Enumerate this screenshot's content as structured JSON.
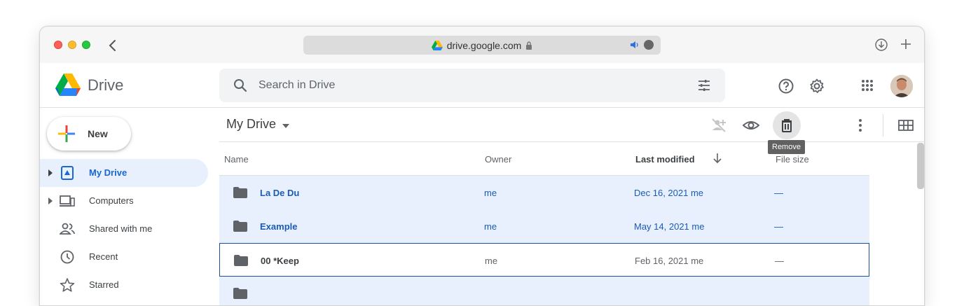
{
  "browser": {
    "url": "drive.google.com"
  },
  "app": {
    "title": "Drive"
  },
  "search": {
    "placeholder": "Search in Drive"
  },
  "sidebar": {
    "new_label": "New",
    "items": [
      {
        "label": "My Drive",
        "active": true,
        "icon": "my-drive-icon"
      },
      {
        "label": "Computers",
        "active": false,
        "icon": "computers-icon"
      },
      {
        "label": "Shared with me",
        "active": false,
        "icon": "shared-icon"
      },
      {
        "label": "Recent",
        "active": false,
        "icon": "clock-icon"
      },
      {
        "label": "Starred",
        "active": false,
        "icon": "star-icon"
      }
    ]
  },
  "toolbar": {
    "folder_title": "My Drive",
    "tooltip": "Remove"
  },
  "table": {
    "columns": {
      "name": "Name",
      "owner": "Owner",
      "modified": "Last modified",
      "size": "File size"
    },
    "rows": [
      {
        "name": "La De Du",
        "owner": "me",
        "modified": "Dec 16, 2021 me",
        "size": "—",
        "state": "selected"
      },
      {
        "name": "Example",
        "owner": "me",
        "modified": "May 14, 2021 me",
        "size": "—",
        "state": "selected"
      },
      {
        "name": "00 *Keep",
        "owner": "me",
        "modified": "Feb 16, 2021 me",
        "size": "—",
        "state": "focused"
      }
    ]
  },
  "colors": {
    "accent": "#1967d2",
    "selection": "#e8f0fe"
  }
}
